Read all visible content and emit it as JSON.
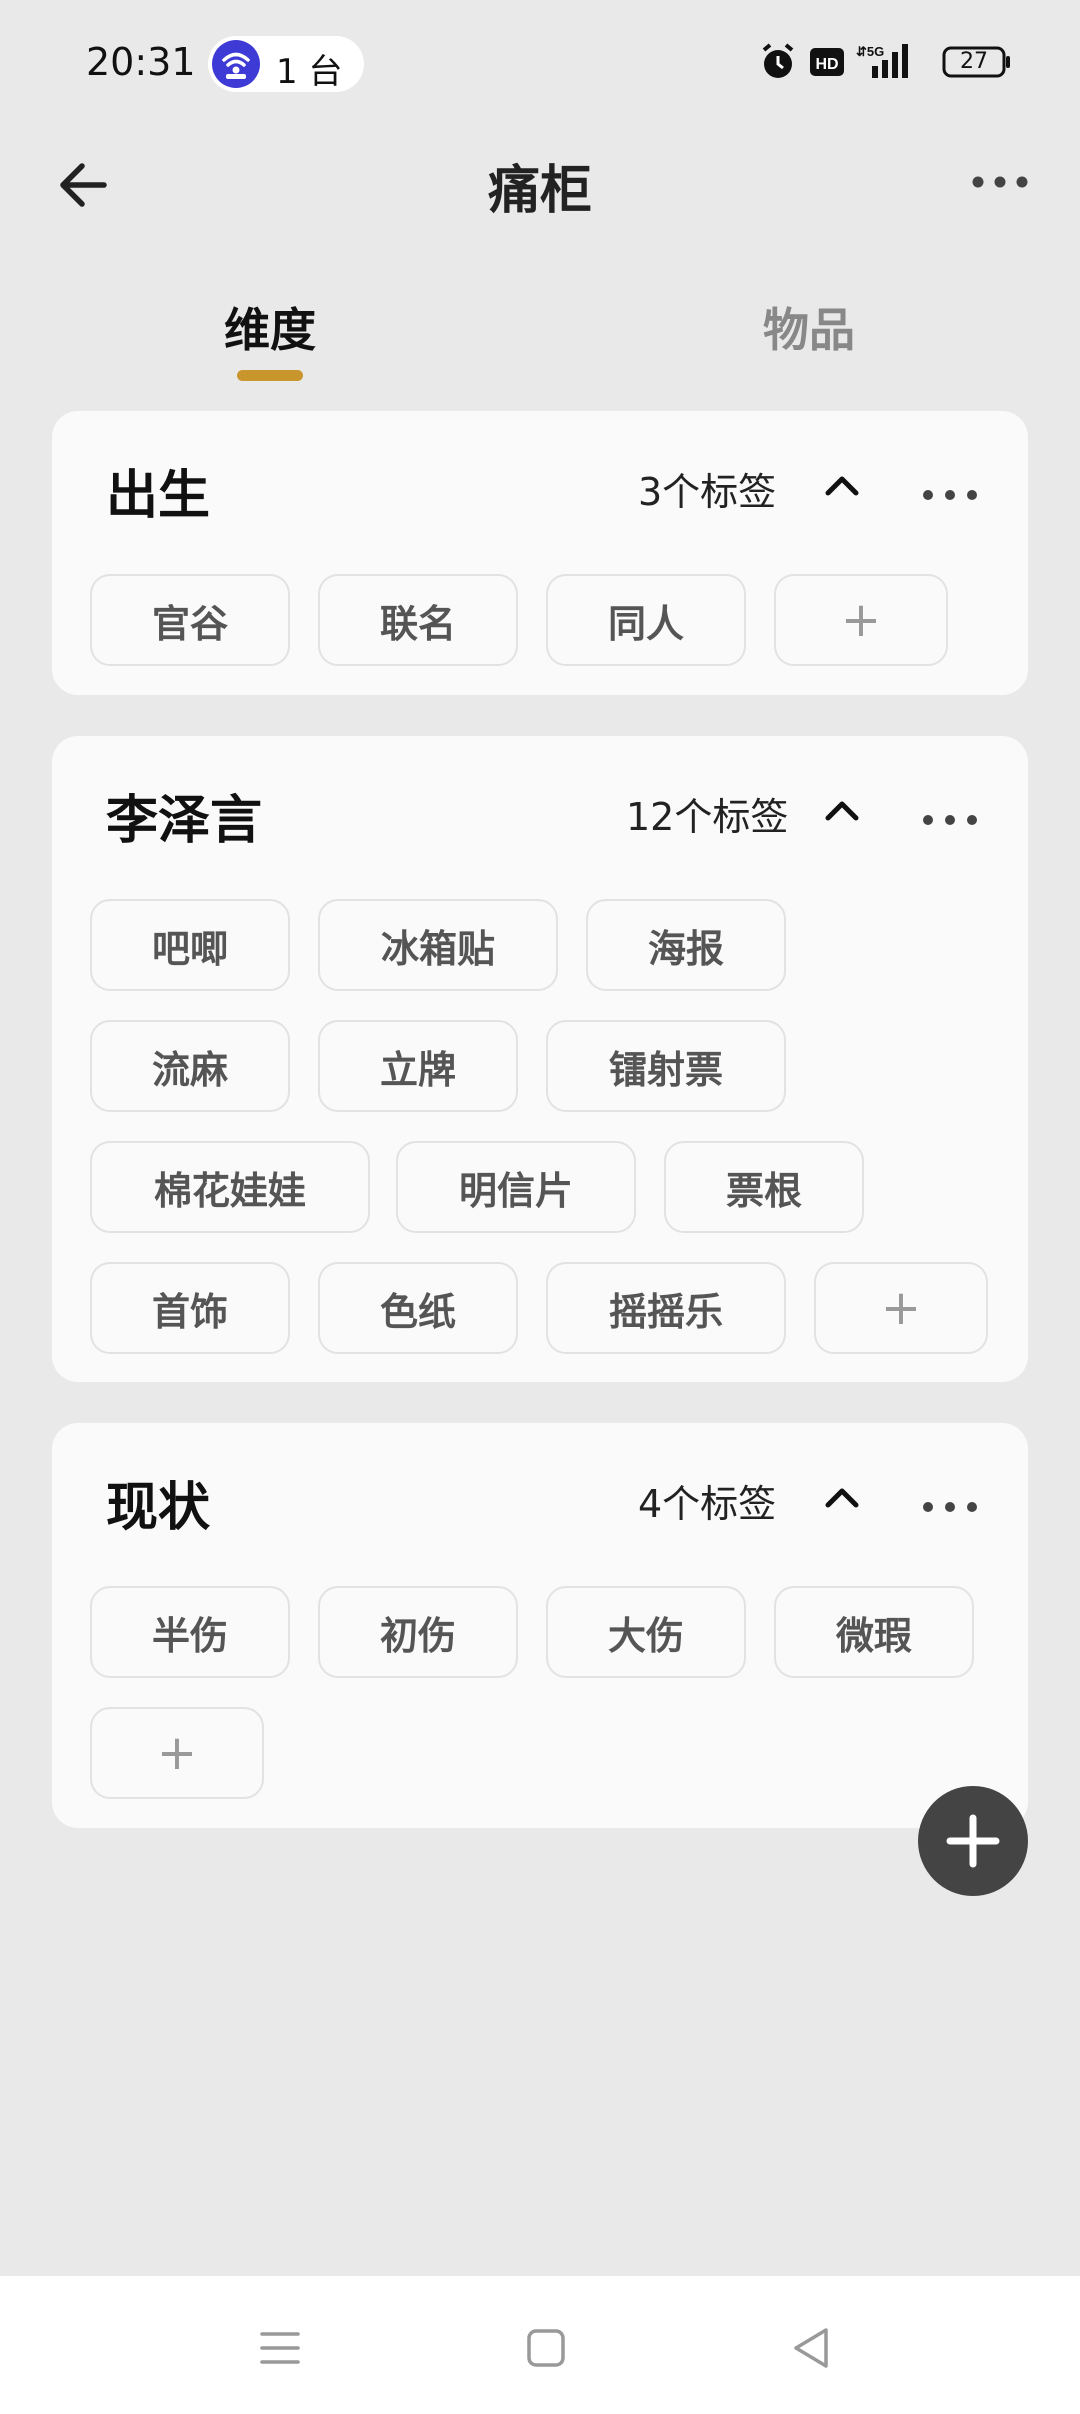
{
  "status_bar": {
    "time": "20:31",
    "hotspot_label": "1 台",
    "battery": "27",
    "icons": [
      "alarm-icon",
      "hd-icon",
      "5g-signal-icon",
      "battery-icon"
    ]
  },
  "header": {
    "title": "痛柜",
    "back_icon": "arrow-left-icon",
    "more_icon": "more-horizontal-icon"
  },
  "tabs": [
    {
      "label": "维度",
      "active": true
    },
    {
      "label": "物品",
      "active": false
    }
  ],
  "accent_color": "#c9952d",
  "cards": [
    {
      "title": "出生",
      "count": "3个标签",
      "tags": [
        "官谷",
        "联名",
        "同人"
      ],
      "add_label": "+"
    },
    {
      "title": "李泽言",
      "count": "12个标签",
      "tags": [
        "吧唧",
        "冰箱贴",
        "海报",
        "流麻",
        "立牌",
        "镭射票",
        "棉花娃娃",
        "明信片",
        "票根",
        "首饰",
        "色纸",
        "摇摇乐"
      ],
      "add_label": "+"
    },
    {
      "title": "现状",
      "count": "4个标签",
      "tags": [
        "半伤",
        "初伤",
        "大伤",
        "微瑕"
      ],
      "add_label": "+"
    }
  ],
  "fab_icon": "plus-icon",
  "nav_bar": {
    "icons": [
      "menu-icon",
      "home-square-icon",
      "back-triangle-icon"
    ]
  }
}
